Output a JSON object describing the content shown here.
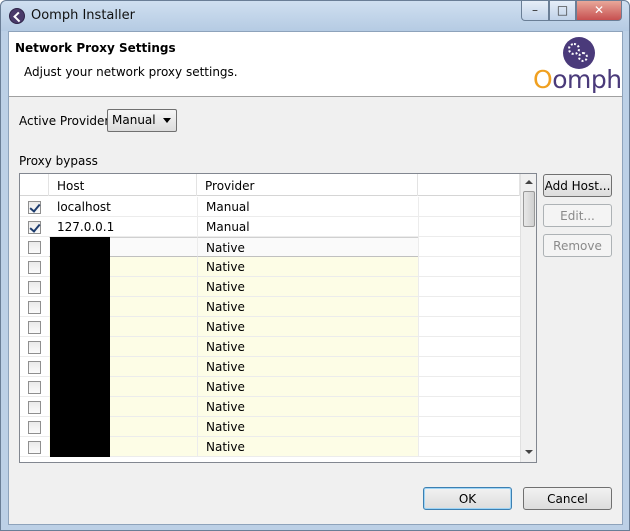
{
  "window": {
    "title": "Oomph Installer"
  },
  "header": {
    "title": "Network Proxy Settings",
    "description": "Adjust your network proxy settings.",
    "logo_text": "Oomph"
  },
  "provider": {
    "label": "Active Provider:",
    "selected": "Manual"
  },
  "bypass": {
    "label": "Proxy bypass",
    "columns": [
      "Host",
      "Provider"
    ],
    "rows": [
      {
        "checked": true,
        "host": "localhost",
        "provider": "Manual",
        "redacted": false
      },
      {
        "checked": true,
        "host": "127.0.0.1",
        "provider": "Manual",
        "redacted": false
      },
      {
        "checked": false,
        "host": "",
        "provider": "Native",
        "redacted": true
      },
      {
        "checked": false,
        "host": "",
        "provider": "Native",
        "redacted": true
      },
      {
        "checked": false,
        "host": "",
        "provider": "Native",
        "redacted": true
      },
      {
        "checked": false,
        "host": "",
        "provider": "Native",
        "redacted": true
      },
      {
        "checked": false,
        "host": "",
        "provider": "Native",
        "redacted": true
      },
      {
        "checked": false,
        "host": "",
        "provider": "Native",
        "redacted": true
      },
      {
        "checked": false,
        "host": "",
        "provider": "Native",
        "redacted": true
      },
      {
        "checked": false,
        "host": "",
        "provider": "Native",
        "redacted": true
      },
      {
        "checked": false,
        "host": "",
        "provider": "Native",
        "redacted": true
      },
      {
        "checked": false,
        "host": "",
        "provider": "Native",
        "redacted": true
      },
      {
        "checked": false,
        "host": "",
        "provider": "Native",
        "redacted": true
      }
    ]
  },
  "buttons": {
    "add": "Add Host...",
    "edit": "Edit...",
    "remove": "Remove",
    "ok": "OK",
    "cancel": "Cancel"
  },
  "colors": {
    "native_row_bg": "#fdfde6",
    "logo_purple": "#4a3a7a",
    "logo_orange": "#f0a020"
  }
}
